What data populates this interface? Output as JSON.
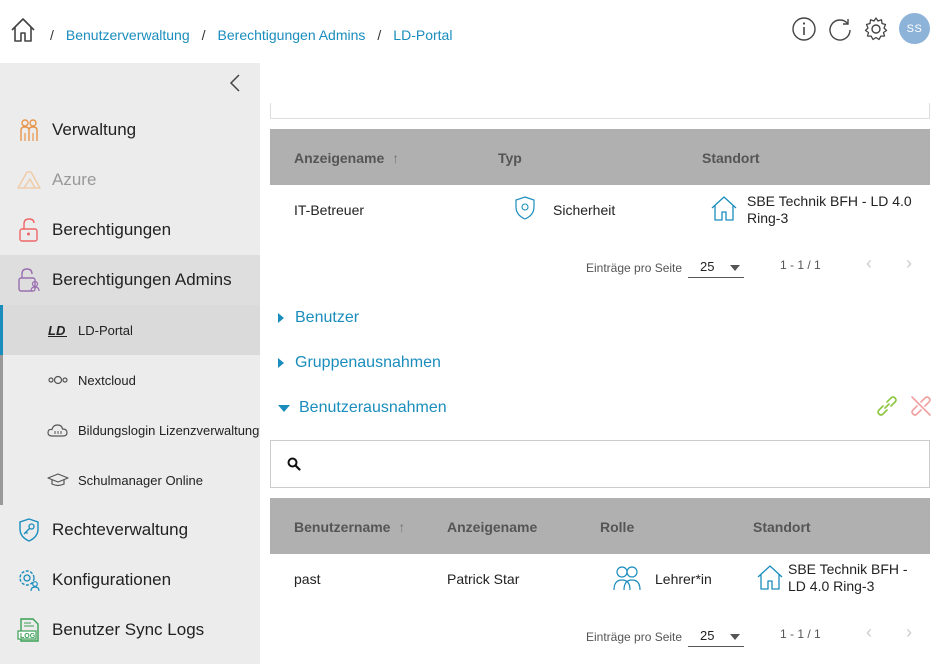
{
  "header": {
    "breadcrumbs": [
      "Benutzerverwaltung",
      "Berechtigungen Admins",
      "LD-Portal"
    ],
    "separator": "/",
    "avatar_initials": "SS",
    "icons": [
      "home-icon",
      "info-icon",
      "refresh-icon",
      "settings-icon"
    ]
  },
  "sidebar": {
    "items": [
      {
        "label": "Verwaltung",
        "icon": "users-icon"
      },
      {
        "label": "Azure",
        "icon": "azure-icon",
        "disabled": true
      },
      {
        "label": "Berechtigungen",
        "icon": "unlock-icon"
      },
      {
        "label": "Berechtigungen Admins",
        "icon": "admin-lock-icon"
      },
      {
        "label": "Rechteverwaltung",
        "icon": "key-shield-icon"
      },
      {
        "label": "Konfigurationen",
        "icon": "gear-users-icon"
      },
      {
        "label": "Benutzer Sync Logs",
        "icon": "log-icon"
      }
    ],
    "subitems": [
      {
        "label": "LD-Portal",
        "icon": "ld-icon",
        "selected": true
      },
      {
        "label": "Nextcloud",
        "icon": "nextcloud-icon"
      },
      {
        "label": "Bildungslogin Lizenzverwaltung",
        "icon": "cloud-icon"
      },
      {
        "label": "Schulmanager Online",
        "icon": "graduation-cap-icon"
      }
    ]
  },
  "groups_table": {
    "columns": [
      "Anzeigename",
      "Typ",
      "Standort"
    ],
    "sort_indicator": "↑",
    "rows": [
      {
        "anzeigename": "IT-Betreuer",
        "typ": "Sicherheit",
        "standort_line1": "SBE Technik BFH - LD 4.0",
        "standort_line2": "Ring-3"
      }
    ],
    "pager": {
      "label": "Einträge pro Seite",
      "per_page": "25",
      "range": "1 - 1 / 1"
    }
  },
  "sections": {
    "benutzer": "Benutzer",
    "gruppenausnahmen": "Gruppenausnahmen",
    "benutzerausnahmen": "Benutzerausnahmen"
  },
  "search": {
    "placeholder": "",
    "value": ""
  },
  "users_table": {
    "columns": [
      "Benutzername",
      "Anzeigename",
      "Rolle",
      "Standort"
    ],
    "sort_indicator": "↑",
    "rows": [
      {
        "benutzername": "past",
        "anzeigename": "Patrick Star",
        "rolle": "Lehrer*in",
        "standort_line1": "SBE Technik BFH -",
        "standort_line2": "LD 4.0 Ring-3"
      }
    ],
    "pager": {
      "label": "Einträge pro Seite",
      "per_page": "25",
      "range": "1 - 1 / 1"
    }
  },
  "colors": {
    "accent": "#1a8dbd",
    "link_green": "#8cc63f",
    "unlink_red": "#f2a0a0",
    "avatar": "#8db3d9"
  }
}
